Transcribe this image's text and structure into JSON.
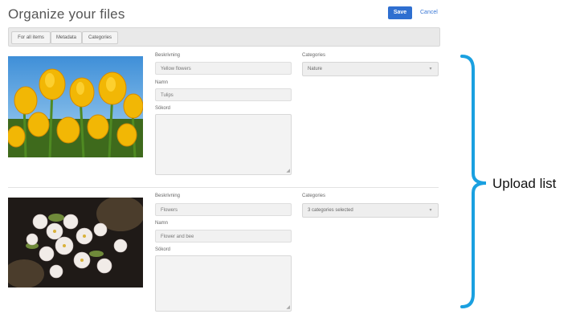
{
  "header": {
    "title": "Organize your files",
    "save_label": "Save",
    "cancel_label": "Cancel"
  },
  "toolbar": {
    "buttons": [
      "For all items",
      "Metadata",
      "Categories"
    ]
  },
  "items": [
    {
      "image": "yellow-tulips-photo",
      "description_label": "Beskrivning",
      "description_value": "Yellow flowers",
      "name_label": "Namn",
      "name_value": "Tulips",
      "keywords_label": "Sökord",
      "categories_label": "Categories",
      "categories_value": "Nature"
    },
    {
      "image": "white-blossoms-photo",
      "description_label": "Beskrivning",
      "description_value": "Flowers",
      "name_label": "Namn",
      "name_value": "Flower and bee",
      "keywords_label": "Sökord",
      "categories_label": "Categories",
      "categories_value": "3 categories selected"
    }
  ],
  "annotation": {
    "label": "Upload list",
    "color": "#1aa0e0"
  },
  "colors": {
    "primary_button": "#2f6fd0",
    "link": "#3a78d6"
  }
}
